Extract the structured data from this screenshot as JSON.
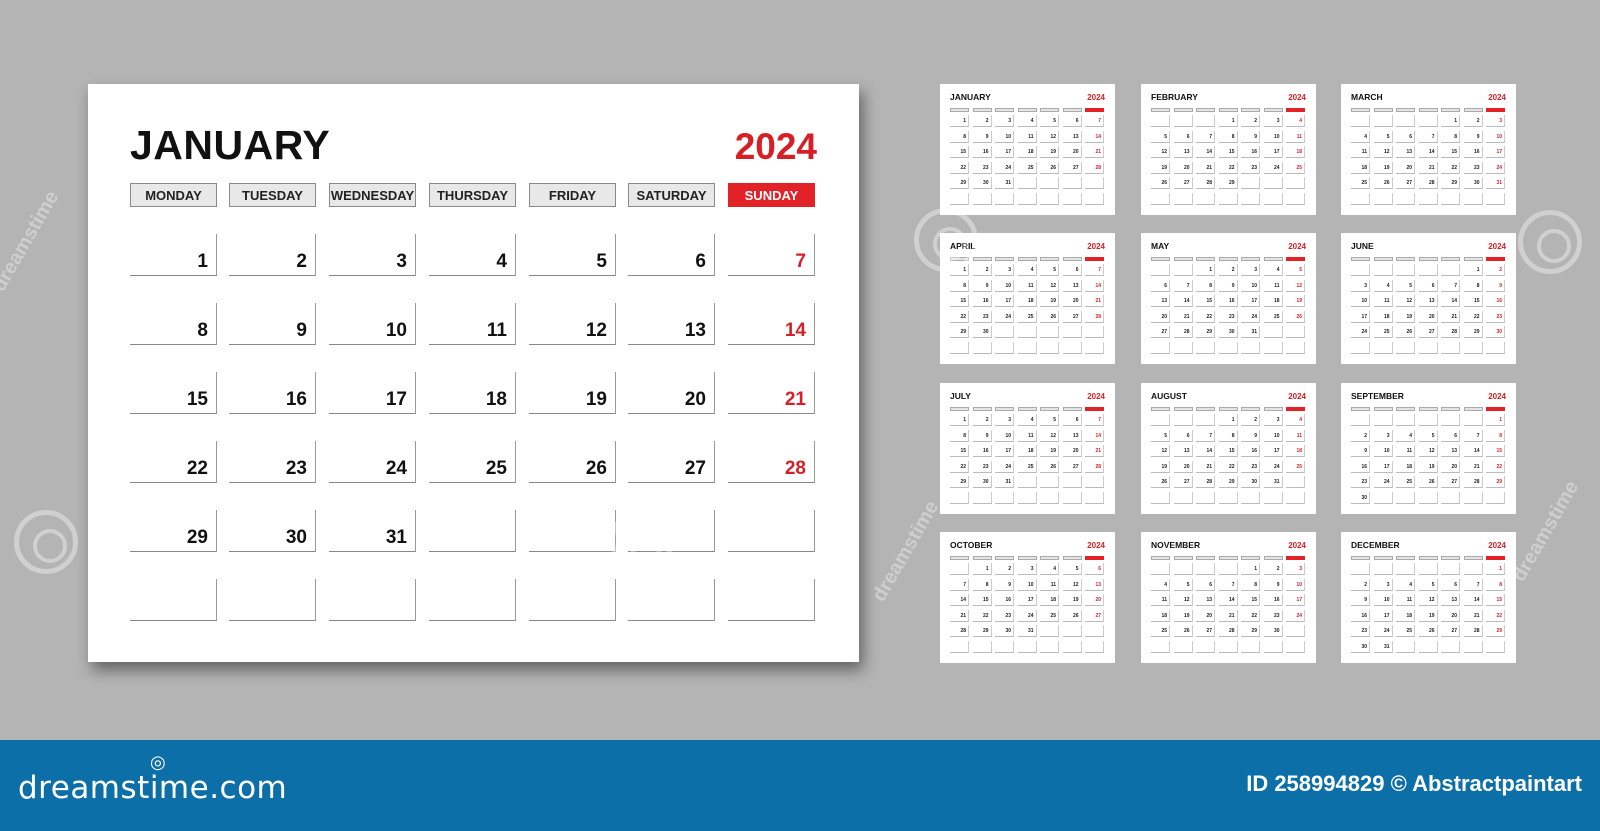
{
  "year": "2024",
  "weekdays": [
    "MONDAY",
    "TUESDAY",
    "WEDNESDAY",
    "THURSDAY",
    "FRIDAY",
    "SATURDAY",
    "SUNDAY"
  ],
  "months": [
    {
      "name": "JANUARY",
      "offset": 0,
      "days": 31
    },
    {
      "name": "FEBRUARY",
      "offset": 3,
      "days": 29
    },
    {
      "name": "MARCH",
      "offset": 4,
      "days": 31
    },
    {
      "name": "APRIL",
      "offset": 0,
      "days": 30
    },
    {
      "name": "MAY",
      "offset": 2,
      "days": 31
    },
    {
      "name": "JUNE",
      "offset": 5,
      "days": 30
    },
    {
      "name": "JULY",
      "offset": 0,
      "days": 31
    },
    {
      "name": "AUGUST",
      "offset": 3,
      "days": 31
    },
    {
      "name": "SEPTEMBER",
      "offset": 6,
      "days": 30
    },
    {
      "name": "OCTOBER",
      "offset": 1,
      "days": 31
    },
    {
      "name": "NOVEMBER",
      "offset": 4,
      "days": 30
    },
    {
      "name": "DECEMBER",
      "offset": 6,
      "days": 31
    }
  ],
  "watermark": {
    "logo": "dreamstime.com",
    "id": "ID 258994829",
    "author": "© Abstractpaintart",
    "overlay": "dreamstime"
  },
  "colors": {
    "background": "#b4b4b4",
    "accent_red": "#e32228",
    "footer_blue": "#0c6fa8"
  }
}
